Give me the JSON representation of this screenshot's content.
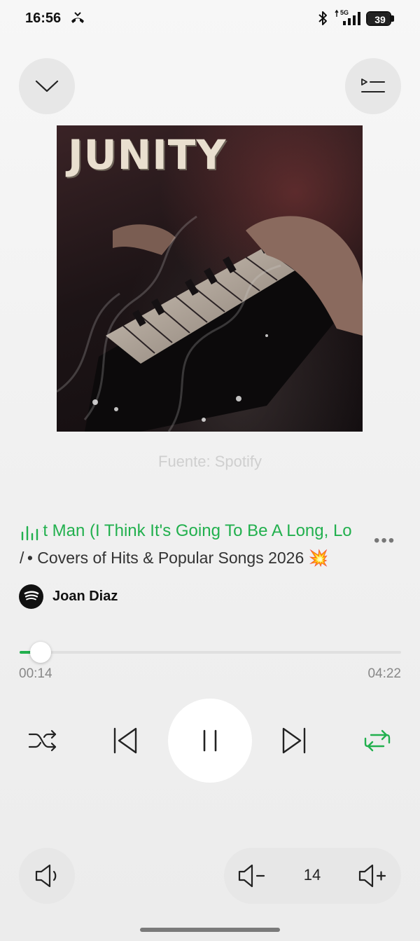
{
  "status_bar": {
    "time": "16:56",
    "network": "5G",
    "battery_level": "39"
  },
  "header": {
    "collapse_icon": "chevron-down-icon",
    "queue_icon": "playlist-queue-icon"
  },
  "album": {
    "cover_title": "JUNITY"
  },
  "source_label": "Fuente: Spotify",
  "track": {
    "title": "et Man (I Think It's Going To Be A Long, Lo",
    "subtitle_lead": "/",
    "subtitle": "• Covers of Hits & Popular Songs 2026 💥",
    "artist": "Joan Diaz"
  },
  "playback": {
    "elapsed": "00:14",
    "total": "04:22",
    "progress_fraction": 0.055,
    "state": "playing"
  },
  "controls": {
    "shuffle_icon": "shuffle-icon",
    "previous_icon": "skip-previous-icon",
    "pause_icon": "pause-icon",
    "next_icon": "skip-next-icon",
    "repeat_icon": "repeat-icon"
  },
  "volume": {
    "value": "14"
  },
  "colors": {
    "accent": "#22b04e",
    "button_bg": "#e7e7e7",
    "background": "#f1f1f1"
  }
}
